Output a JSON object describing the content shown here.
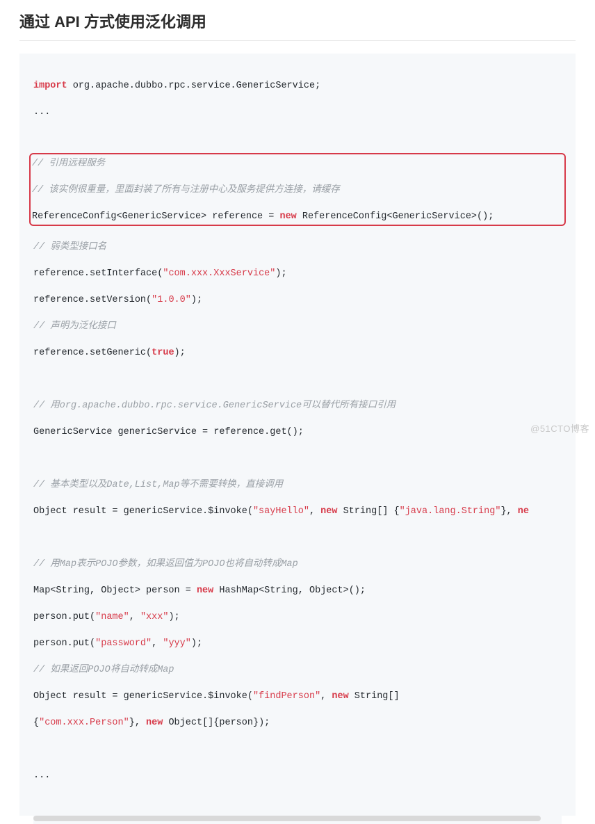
{
  "heading": "通过 API 方式使用泛化调用",
  "code": {
    "l1_kw": "import",
    "l1_rest": " org.apache.dubbo.rpc.service.GenericService;",
    "l2": "...",
    "l3": " ",
    "l4_cmt": "// 引用远程服务",
    "hl_cmt": "// 该实例很重量，里面封装了所有与注册中心及服务提供方连接，请缓存",
    "hl_a": "ReferenceConfig<GenericService> reference = ",
    "hl_kw": "new",
    "hl_b": " ReferenceConfig<GenericService>();",
    "l7_cmt": "// 弱类型接口名",
    "l8_a": "reference.setInterface(",
    "l8_str": "\"com.xxx.XxxService\"",
    "l8_b": ");",
    "l9_a": "reference.setVersion(",
    "l9_str": "\"1.0.0\"",
    "l9_b": ");",
    "l10_cmt": "// 声明为泛化接口",
    "l11_a": "reference.setGeneric(",
    "l11_kw": "true",
    "l11_b": ");",
    "l12": " ",
    "l13_cmt": "// 用org.apache.dubbo.rpc.service.GenericService可以替代所有接口引用",
    "l14": "GenericService genericService = reference.get();",
    "l15": " ",
    "l16_cmt": "// 基本类型以及Date,List,Map等不需要转换，直接调用",
    "l17_a": "Object result = genericService.$invoke(",
    "l17_s1": "\"sayHello\"",
    "l17_b": ", ",
    "l17_kw": "new",
    "l17_c": " String[] {",
    "l17_s2": "\"java.lang.String\"",
    "l17_d": "}, ",
    "l17_kw2": "ne",
    "l18": " ",
    "l19_cmt": "// 用Map表示POJO参数，如果返回值为POJO也将自动转成Map",
    "l20_a": "Map<String, Object> person = ",
    "l20_kw": "new",
    "l20_b": " HashMap<String, Object>();",
    "l21_a": "person.put(",
    "l21_s1": "\"name\"",
    "l21_b": ", ",
    "l21_s2": "\"xxx\"",
    "l21_c": ");",
    "l22_a": "person.put(",
    "l22_s1": "\"password\"",
    "l22_b": ", ",
    "l22_s2": "\"yyy\"",
    "l22_c": ");",
    "l23_cmt": "// 如果返回POJO将自动转成Map",
    "l24_a": "Object result = genericService.$invoke(",
    "l24_s1": "\"findPerson\"",
    "l24_b": ", ",
    "l24_kw": "new",
    "l24_c": " String[]",
    "l25_a": "{",
    "l25_s1": "\"com.xxx.Person\"",
    "l25_b": "}, ",
    "l25_kw": "new",
    "l25_c": " Object[]{person});",
    "l26": " ",
    "l27": "..."
  },
  "watermark": "@51CTO博客"
}
